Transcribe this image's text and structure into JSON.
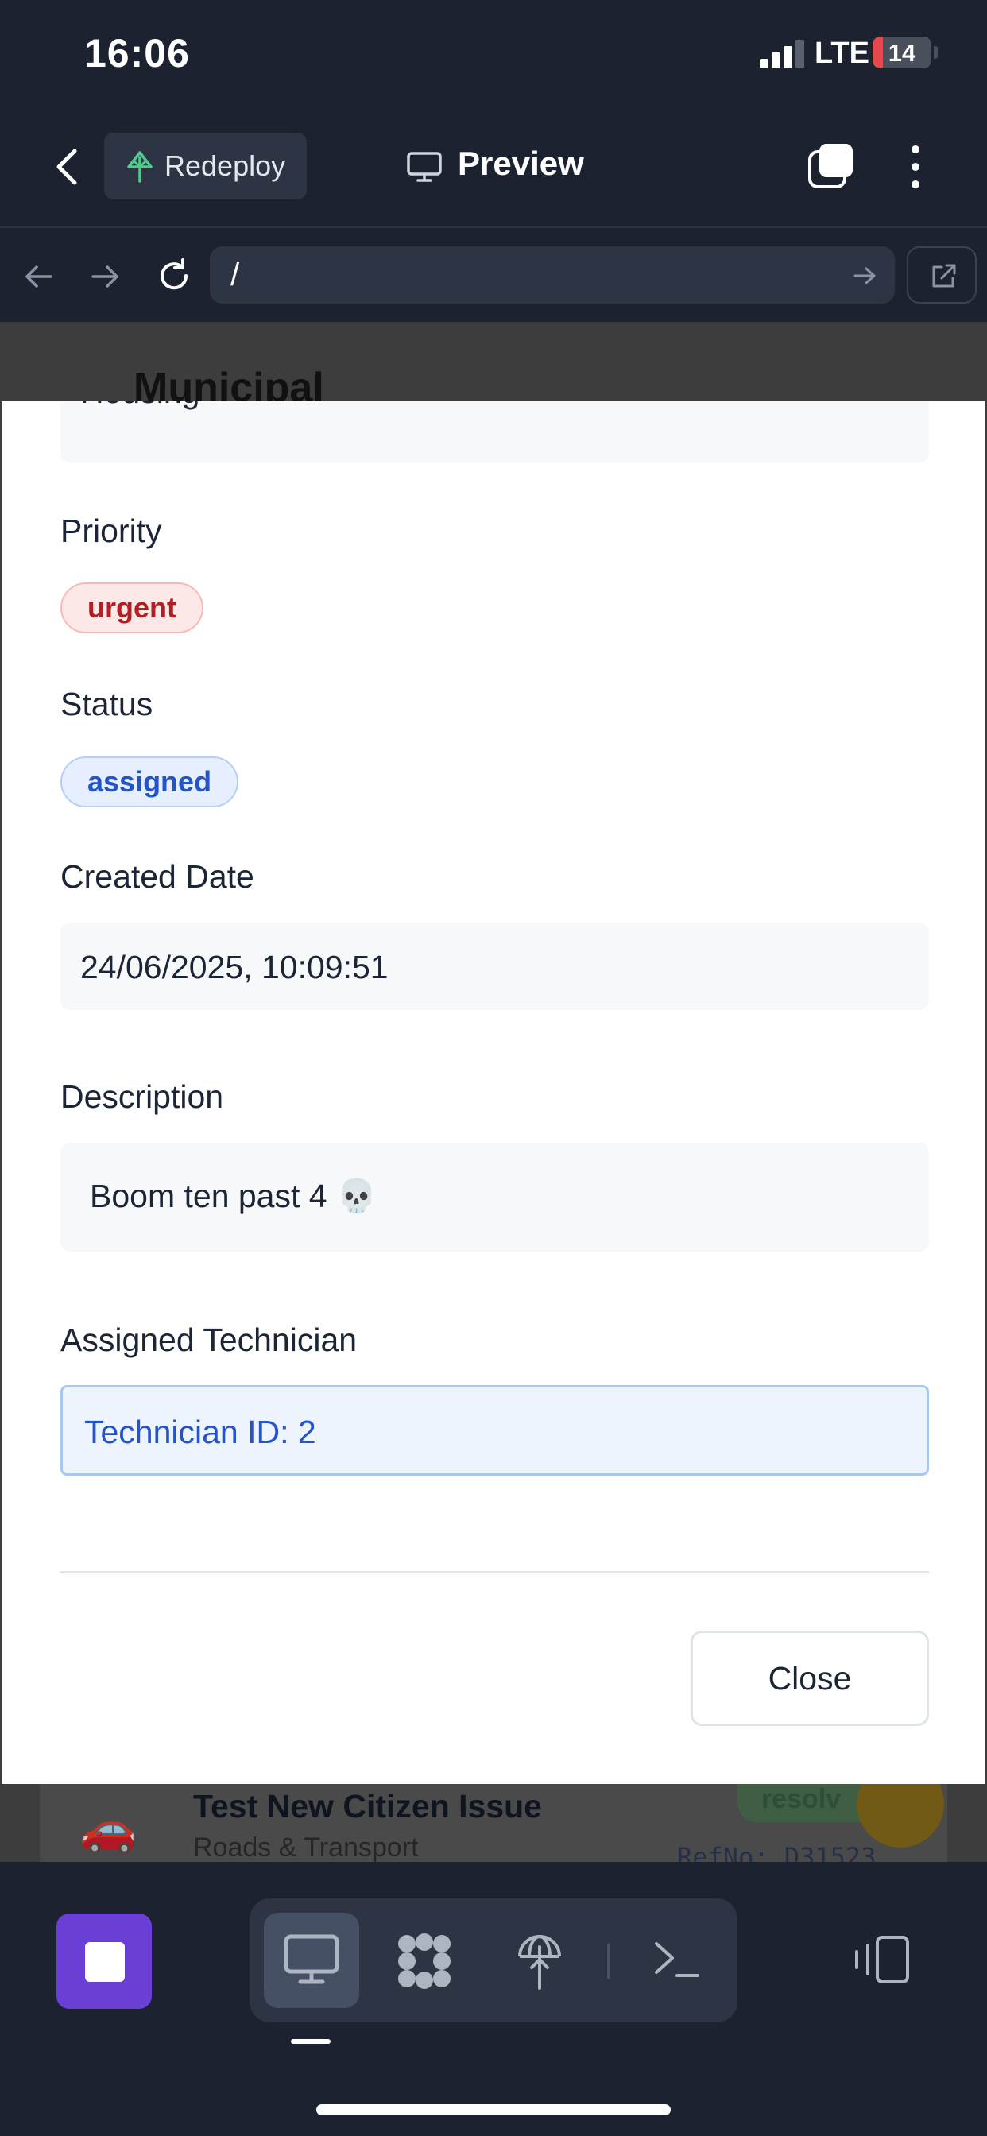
{
  "status_bar": {
    "time": "16:06",
    "network": "LTE",
    "battery": "14",
    "battery_level": 0.14
  },
  "header": {
    "back_icon": "chevron-left-icon",
    "redeploy_label": "Redeploy",
    "redeploy_icon": "tree-icon",
    "preview_label": "Preview",
    "preview_icon": "monitor-icon",
    "tabs_icon": "tabs-icon",
    "more_icon": "vertical-dots-icon"
  },
  "browser": {
    "url": "/",
    "back_icon": "arrow-left-icon",
    "forward_icon": "arrow-right-icon",
    "reload_icon": "reload-icon",
    "go_icon": "arrow-right-icon",
    "open_external_icon": "external-link-icon"
  },
  "background_page": {
    "heading": "Municipal",
    "card_title": "Test New Citizen Issue",
    "card_subtitle": "Roads & Transport",
    "card_badge": "resolv",
    "card_ref": "RefNo: D31523",
    "card_emoji": "🚗"
  },
  "modal": {
    "category_value": "Housing",
    "priority_label": "Priority",
    "priority_value": "urgent",
    "status_label": "Status",
    "status_value": "assigned",
    "created_label": "Created Date",
    "created_value": "24/06/2025, 10:09:51",
    "description_label": "Description",
    "description_value": "Boom ten past 4 💀",
    "technician_label": "Assigned Technician",
    "technician_value": "Technician ID: 2",
    "close_label": "Close"
  },
  "bottom_bar": {
    "tools": [
      "desktop-icon",
      "layers-icon",
      "globe-icon",
      "terminal-icon"
    ],
    "panel_icon": "split-panel-icon"
  },
  "colors": {
    "dark_bg": "#1c2230",
    "accent_purple": "#6a3fd6",
    "urgent_red": "#b31d24",
    "assigned_blue": "#2454c8"
  }
}
